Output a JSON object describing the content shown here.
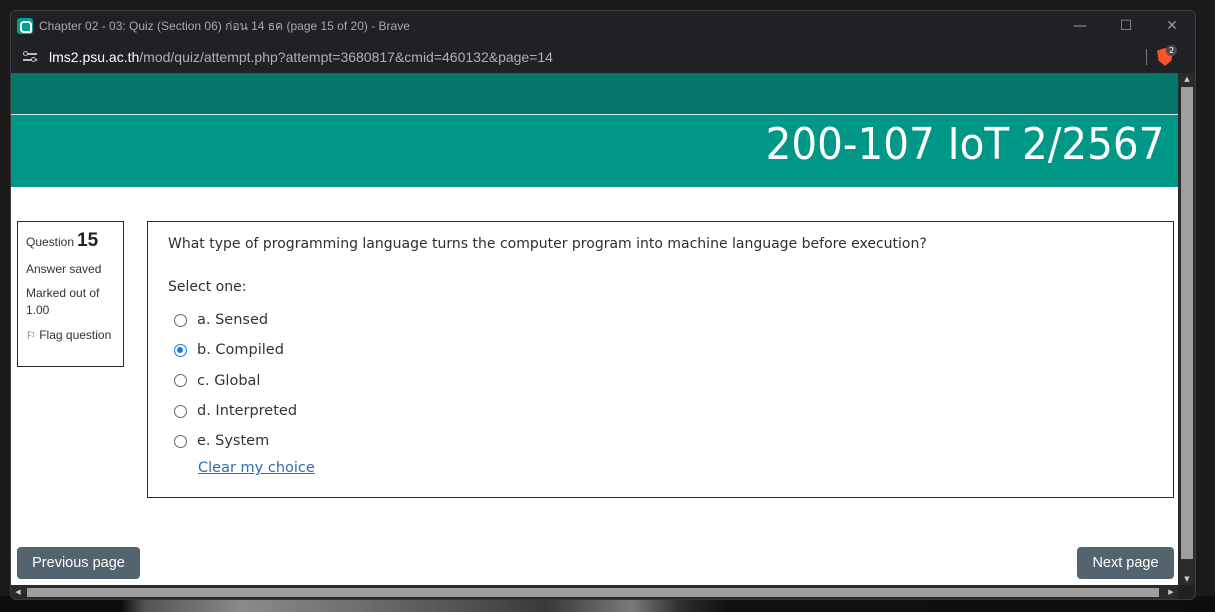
{
  "window": {
    "title": "Chapter 02 - 03: Quiz (Section 06) ก่อน 14 ธค (page 15 of 20) - Brave",
    "minimize": "—",
    "maximize": "☐",
    "close": "✕"
  },
  "address": {
    "host": "lms2.psu.ac.th",
    "path": "/mod/quiz/attempt.php?attempt=3680817&cmid=460132&page=14",
    "shields_badge": "2"
  },
  "header": {
    "course_title": "200-107 IoT 2/2567"
  },
  "question_info": {
    "label": "Question",
    "number": "15",
    "state": "Answer saved",
    "grade": "Marked out of 1.00",
    "flag_label": "Flag question"
  },
  "question": {
    "text": "What type of programming language turns the computer program into machine language before execution?",
    "prompt": "Select one:",
    "answers": [
      {
        "label": "a. Sensed",
        "checked": false
      },
      {
        "label": "b. Compiled",
        "checked": true
      },
      {
        "label": "c. Global",
        "checked": false
      },
      {
        "label": "d. Interpreted",
        "checked": false
      },
      {
        "label": "e. System",
        "checked": false
      }
    ],
    "clear_label": "Clear my choice"
  },
  "navigation": {
    "previous_label": "Previous page",
    "next_label": "Next page"
  },
  "colors": {
    "header_top": "#047668",
    "header_main": "#009787",
    "nav_button": "#54646f",
    "radio_selected": "#1a73e8",
    "link": "#2a6db8"
  }
}
